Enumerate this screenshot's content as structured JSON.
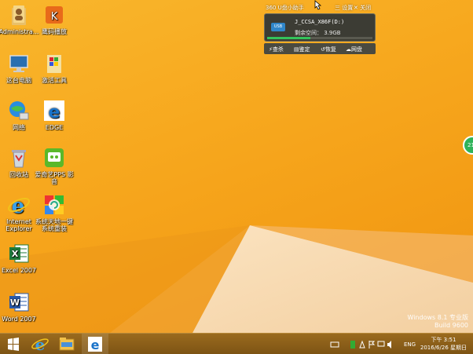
{
  "desktop": {
    "icons": [
      {
        "label": "Administra...",
        "icon": "user-folder-icon"
      },
      {
        "label": "鹰码播放",
        "icon": "kugou-music-icon"
      },
      {
        "label": "这台电脑",
        "icon": "this-pc-icon"
      },
      {
        "label": "激活工具",
        "icon": "activation-tool-icon"
      },
      {
        "label": "网络",
        "icon": "network-icon"
      },
      {
        "label": "EDGE",
        "icon": "edge-icon"
      },
      {
        "label": "回收站",
        "icon": "recycle-bin-icon"
      },
      {
        "label1": "爱奇艺PPS 影",
        "label2": "音",
        "icon": "iqiyi-pps-icon"
      },
      {
        "label1": "Internet",
        "label2": "Explorer",
        "icon": "internet-explorer-icon"
      },
      {
        "label1": "系统天地一键",
        "label2": "系统重装",
        "icon": "system-reinstall-icon"
      },
      {
        "label": "Excel 2007",
        "icon": "excel-icon"
      },
      {
        "label": "Word 2007",
        "icon": "word-icon"
      }
    ]
  },
  "usb_helper": {
    "title": "360 U盘小助手",
    "menu_label": "三 设置",
    "close_label": "✕ 关闭",
    "drive_badge": "USB",
    "drive_name": "J_CCSA_X86F(D:)",
    "free_space": "剩余空间： 3.9GB",
    "used_fraction": 0.41,
    "actions": [
      "查杀",
      "鉴定",
      "恢复",
      "网盘"
    ]
  },
  "side_badge": "21",
  "watermark": {
    "line1": "Windows 8.1 专业版",
    "line2": "Build 9600"
  },
  "taskbar": {
    "pinned": [
      "internet-explorer-icon",
      "file-explorer-icon",
      "edge-icon"
    ],
    "tray": {
      "lang": "ENG",
      "time": "下午 3:51",
      "date": "2016/6/26 星期日"
    }
  },
  "colors": {
    "wallpaper": "#f7a81e",
    "taskbar": "#8a5e19",
    "accent_green": "#34c25a"
  }
}
